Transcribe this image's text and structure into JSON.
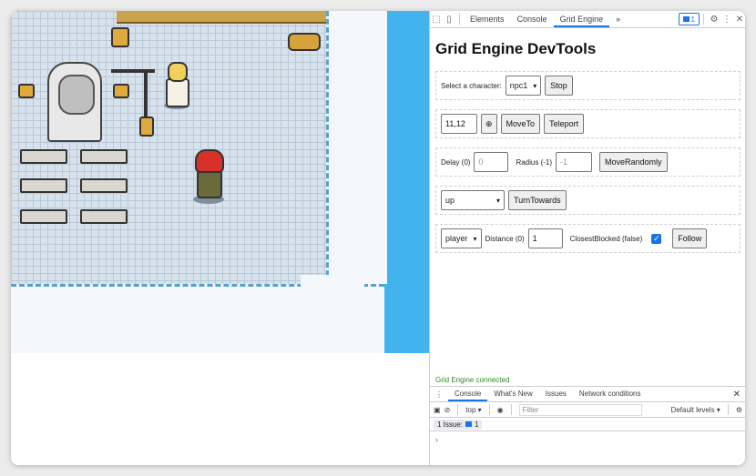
{
  "devtools_tabs": {
    "elements": "Elements",
    "console": "Console",
    "grid_engine": "Grid Engine",
    "more": "»",
    "issue_count": "1"
  },
  "panel": {
    "title": "Grid Engine DevTools",
    "select_character_label": "Select a character:",
    "character_selected": "npc1",
    "stop_label": "Stop",
    "position_value": "11,12",
    "target_icon": "⊕",
    "move_to_label": "MoveTo",
    "teleport_label": "Teleport",
    "delay_label": "Delay (0)",
    "delay_placeholder": "0",
    "radius_label": "Radius (-1)",
    "radius_placeholder": "-1",
    "move_randomly_label": "MoveRandomly",
    "direction_selected": "up",
    "turn_towards_label": "TurnTowards",
    "follow_target_selected": "player",
    "distance_label": "Distance (0)",
    "distance_value": "1",
    "closest_blocked_label": "ClosestBlocked (false)",
    "closest_blocked_checked": true,
    "follow_label": "Follow"
  },
  "status": {
    "connected_text": "Grid Engine connected"
  },
  "drawer": {
    "tabs": [
      "Console",
      "What's New",
      "Issues",
      "Network conditions"
    ],
    "context": "top",
    "filter_placeholder": "Filter",
    "levels": "Default levels",
    "issues_text": "1 Issue:",
    "issues_count": "1",
    "prompt": "›"
  },
  "colors": {
    "accent": "#1a73e8",
    "connected": "#2e8b22",
    "water": "#42b3ec"
  }
}
